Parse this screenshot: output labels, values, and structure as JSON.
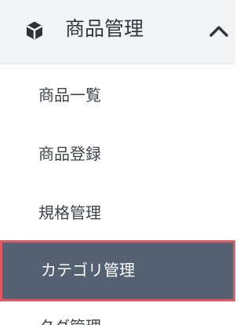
{
  "section": {
    "title": "商品管理",
    "icon": "box-icon",
    "toggle_icon": "chevron-up-icon"
  },
  "items": [
    {
      "label": "商品一覧"
    },
    {
      "label": "商品登録"
    },
    {
      "label": "規格管理"
    },
    {
      "label": "カテゴリ管理",
      "active": true
    },
    {
      "label": "タグ管理"
    }
  ],
  "colors": {
    "header_bg": "#f2f3f5",
    "active_bg": "#536172",
    "active_border": "#e05a63",
    "text": "#3f444b",
    "active_text": "#ffffff"
  }
}
